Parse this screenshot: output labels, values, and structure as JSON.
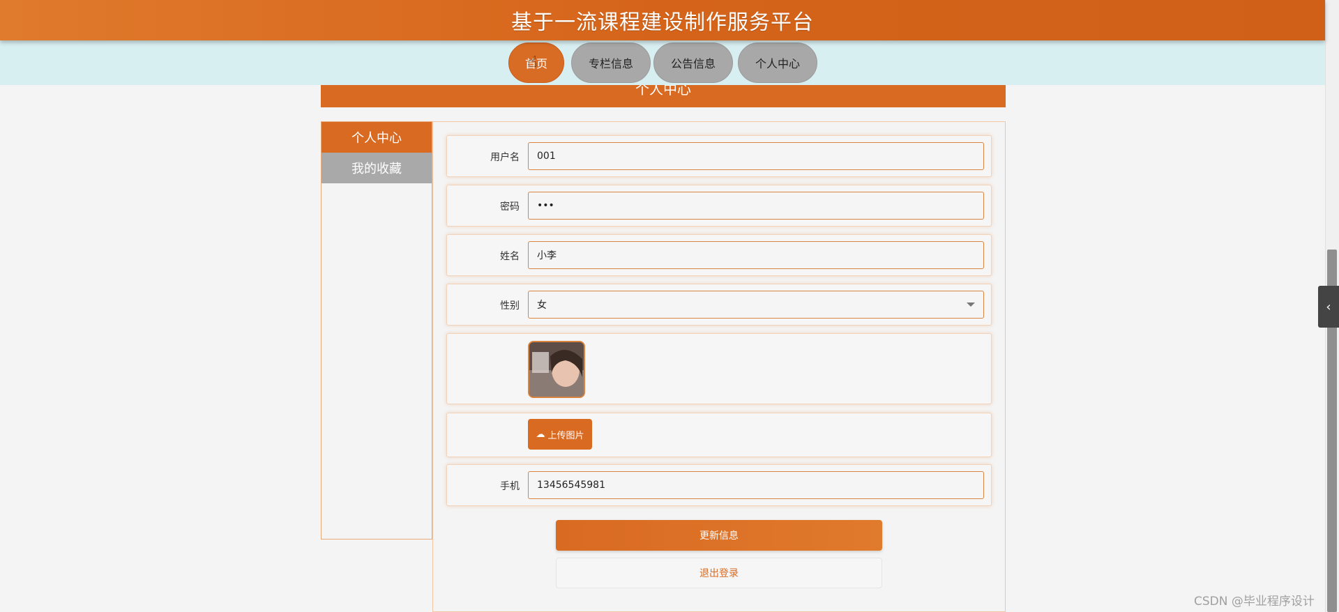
{
  "header": {
    "title": "基于一流课程建设制作服务平台"
  },
  "nav": {
    "items": [
      {
        "label": "首页",
        "active": true
      },
      {
        "label": "专栏信息",
        "active": false
      },
      {
        "label": "公告信息",
        "active": false
      },
      {
        "label": "个人中心",
        "active": false
      }
    ]
  },
  "section": {
    "title": "个人中心"
  },
  "sidebar": {
    "items": [
      {
        "label": "个人中心",
        "active": true
      },
      {
        "label": "我的收藏",
        "active": false
      }
    ]
  },
  "form": {
    "username": {
      "label": "用户名",
      "value": "001"
    },
    "password": {
      "label": "密码",
      "value": "•••"
    },
    "name": {
      "label": "姓名",
      "value": "小李"
    },
    "gender": {
      "label": "性别",
      "value": "女"
    },
    "upload": {
      "label": "上传图片"
    },
    "phone": {
      "label": "手机",
      "value": "13456545981"
    }
  },
  "actions": {
    "update": "更新信息",
    "logout": "退出登录"
  },
  "watermark": "CSDN @毕业程序设计",
  "colors": {
    "accent": "#d96a22",
    "nav_bg": "#d8eff2",
    "inactive": "#a9a9a9"
  }
}
